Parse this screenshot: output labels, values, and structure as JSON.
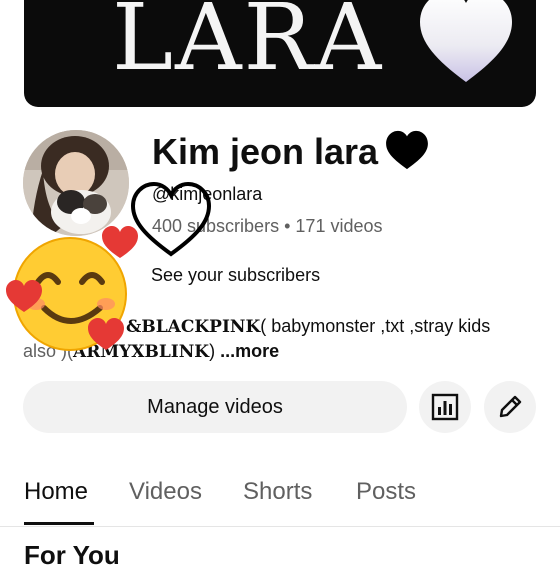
{
  "banner": {
    "text": "LARA"
  },
  "channel": {
    "name": "Kim jeon lara",
    "handle": "@kimjeonlara",
    "subscribers": "400 subscribers",
    "separator": "•",
    "videos": "171 videos",
    "see_subscribers": "See your subscribers"
  },
  "description": {
    "line1_prefix": "",
    "bp": "&BLACKPINK",
    "line1_rest": "( babymonster ,txt ,stray kids",
    "line2_a": "also )(",
    "line2_b": "ARMYXBLINK",
    "line2_c": ") ",
    "more": "...more"
  },
  "actions": {
    "manage_label": "Manage videos",
    "analytics_icon": "bar-chart-icon",
    "edit_icon": "pencil-icon"
  },
  "tabs": [
    {
      "label": "Home"
    },
    {
      "label": "Videos"
    },
    {
      "label": "Shorts"
    },
    {
      "label": "Posts"
    }
  ],
  "section": {
    "title": "For You"
  },
  "colors": {
    "text": "#0f0f0f",
    "muted": "#606060",
    "button_bg": "#f2f2f2",
    "banner_bg": "#0b0b0b"
  }
}
